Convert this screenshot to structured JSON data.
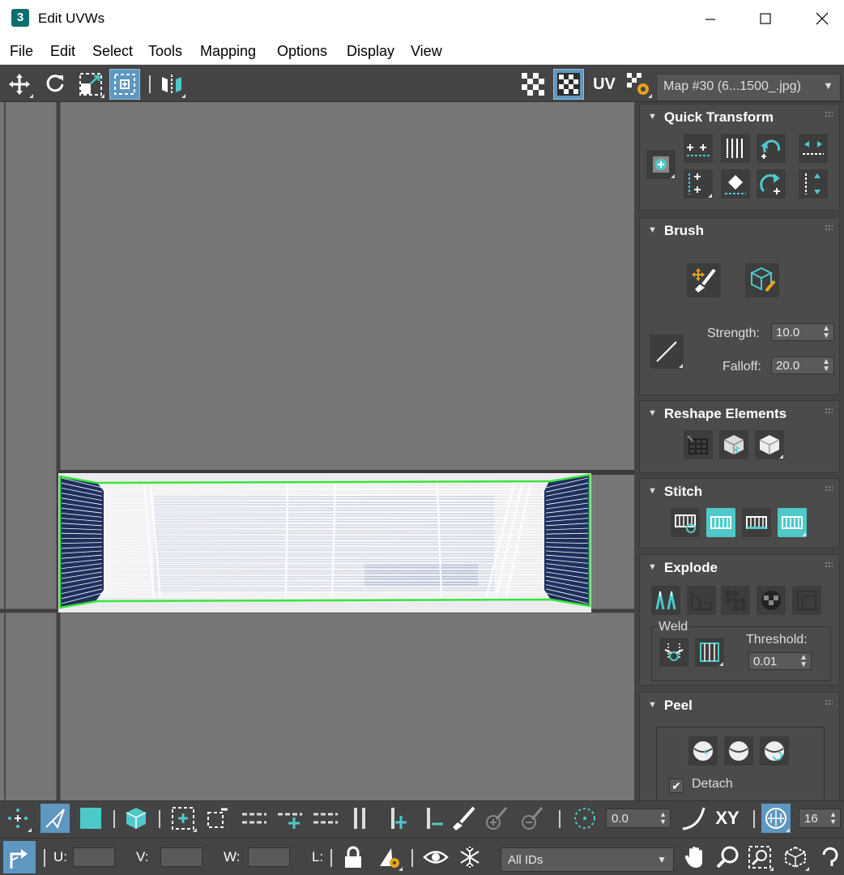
{
  "window": {
    "title": "Edit UVWs",
    "app_icon_text": "3"
  },
  "menu": [
    "File",
    "Edit",
    "Select",
    "Tools",
    "Mapping",
    "Options",
    "Display",
    "View"
  ],
  "toolbar": {
    "left_icons": [
      "move-icon",
      "rotate-icon",
      "scale-icon",
      "freeform-icon",
      "mirror-icon"
    ],
    "right_icons": [
      "checker-pattern-icon",
      "checker-map-icon",
      "uv-label",
      "settings-icon"
    ],
    "uv_text": "UV",
    "map_select": "Map #30 (6...1500_.jpg)"
  },
  "panels": {
    "quick_transform": {
      "title": "Quick Transform"
    },
    "brush": {
      "title": "Brush",
      "strength_label": "Strength:",
      "strength": "10.0",
      "falloff_label": "Falloff:",
      "falloff": "20.0"
    },
    "reshape": {
      "title": "Reshape Elements"
    },
    "stitch": {
      "title": "Stitch"
    },
    "explode": {
      "title": "Explode",
      "weld_label": "Weld",
      "threshold_label": "Threshold:",
      "threshold": "0.01"
    },
    "peel": {
      "title": "Peel",
      "detach_label": "Detach",
      "detach_checked": true
    }
  },
  "bottombar": {
    "angle": "0.0",
    "xy_label": "XY",
    "grid_value": "16"
  },
  "statusbar": {
    "u_label": "U:",
    "u_value": "",
    "v_label": "V:",
    "v_value": "",
    "w_label": "W:",
    "w_value": "",
    "l_label": "L:",
    "ids_select": "All IDs"
  },
  "colors": {
    "accent": "#4ec9c9",
    "active": "#5e97bf",
    "viewport_bg": "#767676",
    "uv_border": "#39e639"
  }
}
